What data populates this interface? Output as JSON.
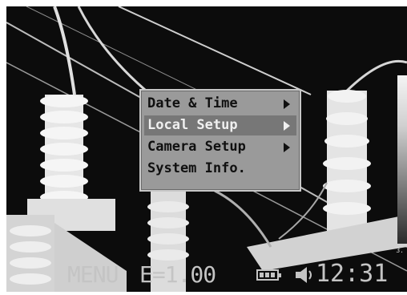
{
  "menu": {
    "items": [
      {
        "label": "Date & Time",
        "has_submenu": true,
        "selected": false
      },
      {
        "label": "Local Setup",
        "has_submenu": true,
        "selected": true
      },
      {
        "label": "Camera Setup",
        "has_submenu": true,
        "selected": false
      },
      {
        "label": "System Info.",
        "has_submenu": false,
        "selected": false
      }
    ]
  },
  "status_bar": {
    "menu_label": "MENU",
    "emissivity": "E=1.00",
    "time": "12:31",
    "battery_icon": "battery-icon",
    "speaker_icon": "speaker-icon"
  },
  "color_scale": {
    "min_label": "3."
  }
}
